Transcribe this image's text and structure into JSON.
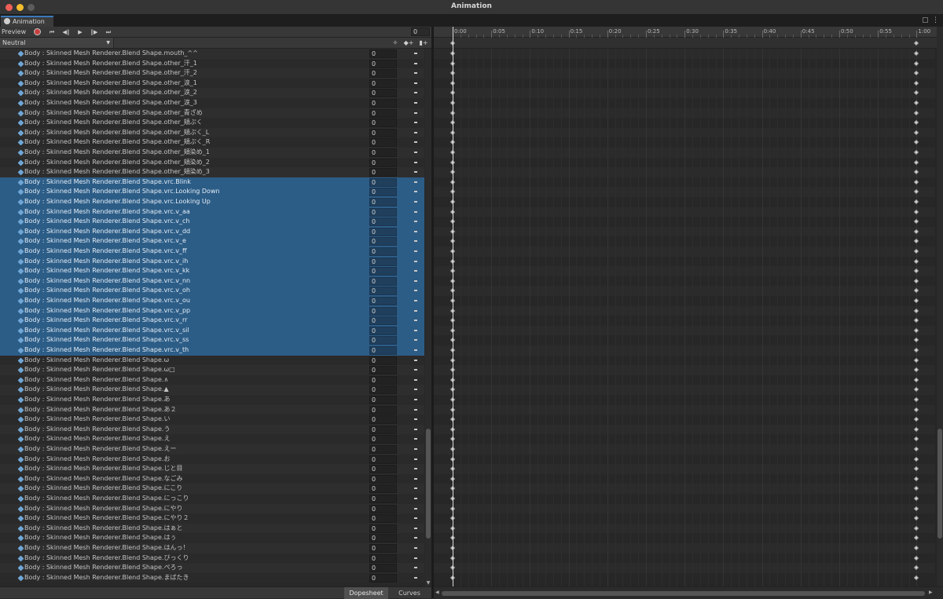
{
  "window": {
    "title": "Animation"
  },
  "tab": {
    "label": "Animation"
  },
  "toolbar": {
    "preview_label": "Preview",
    "frame_value": "0"
  },
  "clip": {
    "selected": "Neutral"
  },
  "bottom_tabs": {
    "dopesheet": "Dopesheet",
    "curves": "Curves"
  },
  "ruler": {
    "labels": [
      "0:00",
      "0:05",
      "0:10",
      "0:15",
      "0:20",
      "0:25",
      "0:30",
      "0:35",
      "0:40",
      "0:45",
      "0:50",
      "0:55",
      "1:00"
    ]
  },
  "properties": [
    {
      "name": "Body : Skinned Mesh Renderer.Blend Shape.mouth_^^",
      "value": "0",
      "selected": false
    },
    {
      "name": "Body : Skinned Mesh Renderer.Blend Shape.other_汗_1",
      "value": "0",
      "selected": false
    },
    {
      "name": "Body : Skinned Mesh Renderer.Blend Shape.other_汗_2",
      "value": "0",
      "selected": false
    },
    {
      "name": "Body : Skinned Mesh Renderer.Blend Shape.other_涙_1",
      "value": "0",
      "selected": false
    },
    {
      "name": "Body : Skinned Mesh Renderer.Blend Shape.other_涙_2",
      "value": "0",
      "selected": false
    },
    {
      "name": "Body : Skinned Mesh Renderer.Blend Shape.other_涙_3",
      "value": "0",
      "selected": false
    },
    {
      "name": "Body : Skinned Mesh Renderer.Blend Shape.other_青ざめ",
      "value": "0",
      "selected": false
    },
    {
      "name": "Body : Skinned Mesh Renderer.Blend Shape.other_頬ぷく",
      "value": "0",
      "selected": false
    },
    {
      "name": "Body : Skinned Mesh Renderer.Blend Shape.other_頬ぷく_L",
      "value": "0",
      "selected": false
    },
    {
      "name": "Body : Skinned Mesh Renderer.Blend Shape.other_頬ぷく_R",
      "value": "0",
      "selected": false
    },
    {
      "name": "Body : Skinned Mesh Renderer.Blend Shape.other_頬染め_1",
      "value": "0",
      "selected": false
    },
    {
      "name": "Body : Skinned Mesh Renderer.Blend Shape.other_頬染め_2",
      "value": "0",
      "selected": false
    },
    {
      "name": "Body : Skinned Mesh Renderer.Blend Shape.other_頬染め_3",
      "value": "0",
      "selected": false
    },
    {
      "name": "Body : Skinned Mesh Renderer.Blend Shape.vrc.Blink",
      "value": "0",
      "selected": true
    },
    {
      "name": "Body : Skinned Mesh Renderer.Blend Shape.vrc.Looking Down",
      "value": "0",
      "selected": true
    },
    {
      "name": "Body : Skinned Mesh Renderer.Blend Shape.vrc.Looking Up",
      "value": "0",
      "selected": true
    },
    {
      "name": "Body : Skinned Mesh Renderer.Blend Shape.vrc.v_aa",
      "value": "0",
      "selected": true
    },
    {
      "name": "Body : Skinned Mesh Renderer.Blend Shape.vrc.v_ch",
      "value": "0",
      "selected": true
    },
    {
      "name": "Body : Skinned Mesh Renderer.Blend Shape.vrc.v_dd",
      "value": "0",
      "selected": true
    },
    {
      "name": "Body : Skinned Mesh Renderer.Blend Shape.vrc.v_e",
      "value": "0",
      "selected": true
    },
    {
      "name": "Body : Skinned Mesh Renderer.Blend Shape.vrc.v_ff",
      "value": "0",
      "selected": true
    },
    {
      "name": "Body : Skinned Mesh Renderer.Blend Shape.vrc.v_ih",
      "value": "0",
      "selected": true
    },
    {
      "name": "Body : Skinned Mesh Renderer.Blend Shape.vrc.v_kk",
      "value": "0",
      "selected": true
    },
    {
      "name": "Body : Skinned Mesh Renderer.Blend Shape.vrc.v_nn",
      "value": "0",
      "selected": true
    },
    {
      "name": "Body : Skinned Mesh Renderer.Blend Shape.vrc.v_oh",
      "value": "0",
      "selected": true
    },
    {
      "name": "Body : Skinned Mesh Renderer.Blend Shape.vrc.v_ou",
      "value": "0",
      "selected": true
    },
    {
      "name": "Body : Skinned Mesh Renderer.Blend Shape.vrc.v_pp",
      "value": "0",
      "selected": true
    },
    {
      "name": "Body : Skinned Mesh Renderer.Blend Shape.vrc.v_rr",
      "value": "0",
      "selected": true
    },
    {
      "name": "Body : Skinned Mesh Renderer.Blend Shape.vrc.v_sil",
      "value": "0",
      "selected": true
    },
    {
      "name": "Body : Skinned Mesh Renderer.Blend Shape.vrc.v_ss",
      "value": "0",
      "selected": true
    },
    {
      "name": "Body : Skinned Mesh Renderer.Blend Shape.vrc.v_th",
      "value": "0",
      "selected": true
    },
    {
      "name": "Body : Skinned Mesh Renderer.Blend Shape.ω",
      "value": "0",
      "selected": false
    },
    {
      "name": "Body : Skinned Mesh Renderer.Blend Shape.ω□",
      "value": "0",
      "selected": false
    },
    {
      "name": "Body : Skinned Mesh Renderer.Blend Shape.∧",
      "value": "0",
      "selected": false
    },
    {
      "name": "Body : Skinned Mesh Renderer.Blend Shape.▲",
      "value": "0",
      "selected": false
    },
    {
      "name": "Body : Skinned Mesh Renderer.Blend Shape.あ",
      "value": "0",
      "selected": false
    },
    {
      "name": "Body : Skinned Mesh Renderer.Blend Shape.あ２",
      "value": "0",
      "selected": false
    },
    {
      "name": "Body : Skinned Mesh Renderer.Blend Shape.い",
      "value": "0",
      "selected": false
    },
    {
      "name": "Body : Skinned Mesh Renderer.Blend Shape.う",
      "value": "0",
      "selected": false
    },
    {
      "name": "Body : Skinned Mesh Renderer.Blend Shape.え",
      "value": "0",
      "selected": false
    },
    {
      "name": "Body : Skinned Mesh Renderer.Blend Shape.えー",
      "value": "0",
      "selected": false
    },
    {
      "name": "Body : Skinned Mesh Renderer.Blend Shape.お",
      "value": "0",
      "selected": false
    },
    {
      "name": "Body : Skinned Mesh Renderer.Blend Shape.じと目",
      "value": "0",
      "selected": false
    },
    {
      "name": "Body : Skinned Mesh Renderer.Blend Shape.なごみ",
      "value": "0",
      "selected": false
    },
    {
      "name": "Body : Skinned Mesh Renderer.Blend Shape.にこり",
      "value": "0",
      "selected": false
    },
    {
      "name": "Body : Skinned Mesh Renderer.Blend Shape.にっこり",
      "value": "0",
      "selected": false
    },
    {
      "name": "Body : Skinned Mesh Renderer.Blend Shape.にやり",
      "value": "0",
      "selected": false
    },
    {
      "name": "Body : Skinned Mesh Renderer.Blend Shape.にやり２",
      "value": "0",
      "selected": false
    },
    {
      "name": "Body : Skinned Mesh Renderer.Blend Shape.はぁと",
      "value": "0",
      "selected": false
    },
    {
      "name": "Body : Skinned Mesh Renderer.Blend Shape.はぅ",
      "value": "0",
      "selected": false
    },
    {
      "name": "Body : Skinned Mesh Renderer.Blend Shape.はんっ！",
      "value": "0",
      "selected": false
    },
    {
      "name": "Body : Skinned Mesh Renderer.Blend Shape.びっくり",
      "value": "0",
      "selected": false
    },
    {
      "name": "Body : Skinned Mesh Renderer.Blend Shape.ぺろっ",
      "value": "0",
      "selected": false
    },
    {
      "name": "Body : Skinned Mesh Renderer.Blend Shape.まばたき",
      "value": "0",
      "selected": false
    }
  ],
  "keyframe_times": [
    "0:00",
    "1:00"
  ],
  "icons": {
    "record": "record-icon",
    "first_key": "first-keyframe-icon",
    "prev_key": "previous-keyframe-icon",
    "play": "play-icon",
    "next_key": "next-keyframe-icon",
    "last_key": "last-keyframe-icon",
    "filter": "filter-icon",
    "add_key": "add-keyframe-icon",
    "add_event": "add-event-icon",
    "lock": "lock-icon",
    "menu": "more-menu-icon",
    "property": "blend-shape-property-icon"
  },
  "colors": {
    "selection": "#2c5d87",
    "accent": "#3a79bb",
    "record": "#c84040"
  }
}
